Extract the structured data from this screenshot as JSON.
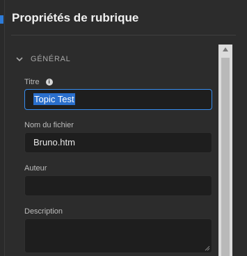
{
  "panel": {
    "title": "Propriétés de rubrique",
    "section": "GÉNÉRAL",
    "fields": {
      "titre": {
        "label": "Titre",
        "value": "Topic Test"
      },
      "filename": {
        "label": "Nom du fichier",
        "value": "Bruno.htm"
      },
      "author": {
        "label": "Auteur",
        "value": ""
      },
      "description": {
        "label": "Description",
        "value": ""
      }
    },
    "info_glyph": "i"
  },
  "colors": {
    "panel_bg": "#2c2c2c",
    "field_bg": "#1e1e1e",
    "focus_border": "#378ef0",
    "selection": "#2a6fcc"
  }
}
